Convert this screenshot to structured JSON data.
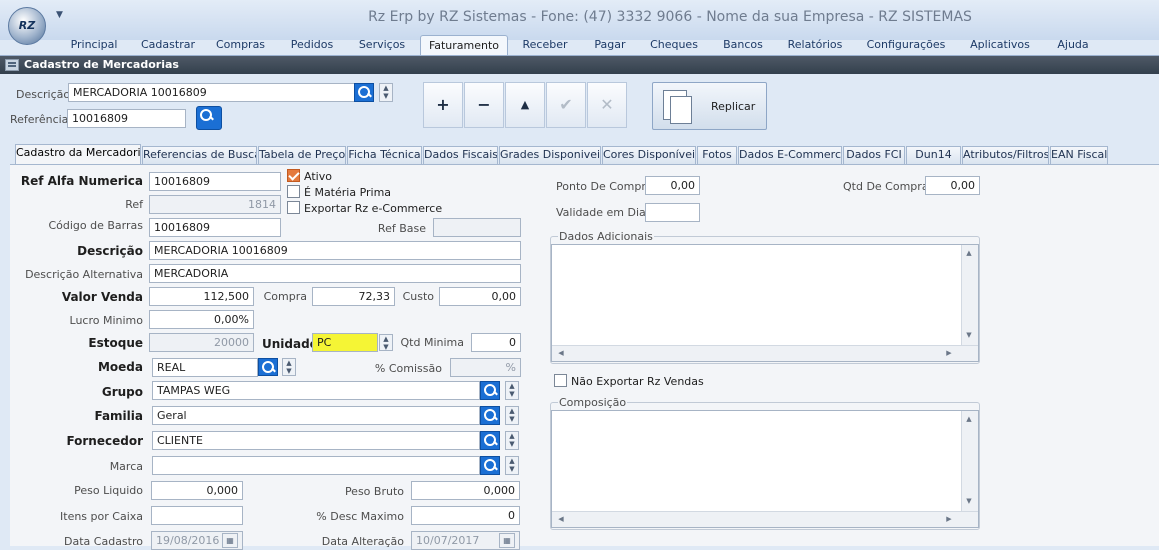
{
  "app": {
    "title": "Rz Erp by RZ Sistemas - Fone: (47) 3332 9066 - Nome da sua Empresa - RZ SISTEMAS",
    "orb_text": "RZ"
  },
  "ribbon": {
    "tabs": [
      {
        "label": "Principal"
      },
      {
        "label": "Cadastrar"
      },
      {
        "label": "Compras"
      },
      {
        "label": "Pedidos"
      },
      {
        "label": "Serviços"
      },
      {
        "label": "Faturamento",
        "active": true
      },
      {
        "label": "Receber"
      },
      {
        "label": "Pagar"
      },
      {
        "label": "Cheques"
      },
      {
        "label": "Bancos"
      },
      {
        "label": "Relatórios"
      },
      {
        "label": "Configurações"
      },
      {
        "label": "Aplicativos"
      },
      {
        "label": "Ajuda"
      }
    ]
  },
  "form": {
    "title": "Cadastro de Mercadorias"
  },
  "header": {
    "descricao_label": "Descrição",
    "descricao_value": "MERCADORIA 10016809",
    "referencia_label": "Referência",
    "referencia_value": "10016809",
    "nav_buttons": [
      {
        "name": "add",
        "glyph": "+"
      },
      {
        "name": "remove",
        "glyph": "−"
      },
      {
        "name": "up",
        "glyph": "▲"
      },
      {
        "name": "confirm",
        "glyph": "✔"
      },
      {
        "name": "cancel",
        "glyph": "✕"
      }
    ],
    "replicar_label": "Replicar"
  },
  "tabs": [
    {
      "label": "Cadastro da Mercadoria",
      "active": true
    },
    {
      "label": "Referencias de Busca"
    },
    {
      "label": "Tabela de Preço"
    },
    {
      "label": "Ficha Técnica"
    },
    {
      "label": "Dados Fiscais"
    },
    {
      "label": "Grades Disponiveis"
    },
    {
      "label": "Cores Disponíveis"
    },
    {
      "label": "Fotos"
    },
    {
      "label": "Dados E-Commerce"
    },
    {
      "label": "Dados FCI"
    },
    {
      "label": "Dun14"
    },
    {
      "label": "Atributos/Filtros"
    },
    {
      "label": "EAN Fiscal"
    }
  ],
  "fields": {
    "ref_alfa_label": "Ref Alfa Numerica",
    "ref_alfa_value": "10016809",
    "ref_label": "Ref",
    "ref_value": "1814",
    "cod_barras_label": "Código de Barras",
    "cod_barras_value": "10016809",
    "ref_base_label": "Ref Base",
    "ref_base_value": "",
    "descricao_label": "Descrição",
    "descricao_value": "MERCADORIA 10016809",
    "desc_alt_label": "Descrição Alternativa",
    "desc_alt_value": "MERCADORIA",
    "valor_venda_label": "Valor Venda",
    "valor_venda_value": "112,500",
    "compra_label": "Compra",
    "compra_value": "72,33",
    "custo_label": "Custo",
    "custo_value": "0,00",
    "lucro_label": "Lucro Minimo",
    "lucro_value": "0,00%",
    "estoque_label": "Estoque",
    "estoque_value": "20000",
    "unidade_label": "Unidade",
    "unidade_value": "PC",
    "qtd_minima_label": "Qtd Minima",
    "qtd_minima_value": "0",
    "moeda_label": "Moeda",
    "moeda_value": "REAL",
    "comissao_label": "% Comissão",
    "comissao_value": "%",
    "grupo_label": "Grupo",
    "grupo_value": "TAMPAS WEG",
    "familia_label": "Familia",
    "familia_value": "Geral",
    "fornecedor_label": "Fornecedor",
    "fornecedor_value": "CLIENTE",
    "marca_label": "Marca",
    "marca_value": "",
    "peso_liq_label": "Peso Liquido",
    "peso_liq_value": "0,000",
    "peso_bruto_label": "Peso Bruto",
    "peso_bruto_value": "0,000",
    "itens_caixa_label": "Itens por Caixa",
    "itens_caixa_value": "",
    "desc_max_label": "% Desc Maximo",
    "desc_max_value": "0",
    "data_cad_label": "Data Cadastro",
    "data_cad_value": "19/08/2016",
    "data_alt_label": "Data Alteração",
    "data_alt_value": "10/07/2017"
  },
  "checks": {
    "ativo": {
      "label": "Ativo",
      "checked": true
    },
    "materia_prima": {
      "label": "É Matéria Prima",
      "checked": false
    },
    "exportar_ecommerce": {
      "label": "Exportar Rz e-Commerce",
      "checked": false
    },
    "nao_exportar_vendas": {
      "label": "Não Exportar Rz Vendas",
      "checked": false
    }
  },
  "right": {
    "ponto_compra_label": "Ponto De Compra",
    "ponto_compra_value": "0,00",
    "qtd_compra_label": "Qtd De Compra",
    "qtd_compra_value": "0,00",
    "validade_label": "Validade em Dias",
    "validade_value": "",
    "dados_adicionais_label": "Dados Adicionais",
    "composicao_label": "Composição"
  },
  "colors": {
    "highlight": "#f5f535",
    "accent": "#1b6fd4",
    "check": "#e47a3e"
  }
}
